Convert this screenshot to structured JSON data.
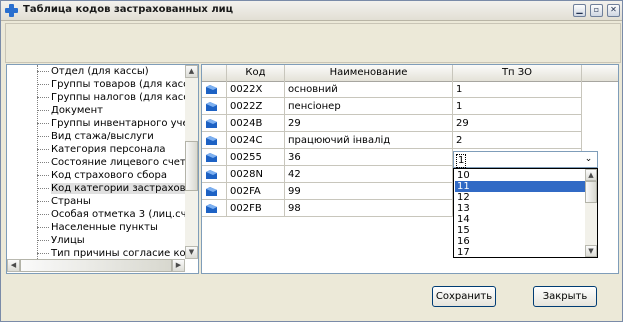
{
  "window": {
    "title": "Таблица кодов застрахованных лиц"
  },
  "tree": {
    "items": [
      "Отдел (для кассы)",
      "Группы товаров (для кассы)",
      "Группы налогов (для кассы)",
      "Документ",
      "Группы инвентарного учета (бу",
      "Вид стажа/выслуги",
      "Категория персонала",
      "Состояние лицевого счета",
      "Код страхового сбора",
      "Код категории застрахованного",
      "Страны",
      "Особая отметка 3 (лиц.счет)",
      "Населенные пункты",
      "Улицы",
      "Тип причины согласие которой"
    ]
  },
  "grid": {
    "columns": [
      "Код",
      "Наименование",
      "Тп ЗО"
    ],
    "rows": [
      {
        "code": "0022X",
        "name": "основний",
        "tp": "1"
      },
      {
        "code": "0022Z",
        "name": "пенсіонер",
        "tp": "1"
      },
      {
        "code": "0024B",
        "name": "29",
        "tp": "29"
      },
      {
        "code": "0024C",
        "name": "працюючий інвалід",
        "tp": "2"
      },
      {
        "code": "00255",
        "name": "36",
        "tp": "1"
      },
      {
        "code": "0028N",
        "name": "42",
        "tp": ""
      },
      {
        "code": "002FA",
        "name": "99",
        "tp": ""
      },
      {
        "code": "002FB",
        "name": "98",
        "tp": ""
      }
    ]
  },
  "combo": {
    "value": "1",
    "options": [
      "10",
      "11",
      "12",
      "13",
      "14",
      "15",
      "16",
      "17"
    ],
    "selected_index": 1
  },
  "buttons": {
    "save": "Сохранить",
    "close": "Закрыть"
  },
  "colors": {
    "selection": "#316ac5",
    "border": "#7f9db9",
    "window_bg": "#ece9d8"
  }
}
